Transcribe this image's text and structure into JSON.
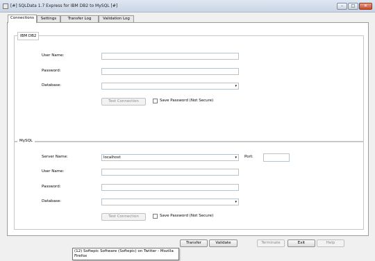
{
  "window": {
    "title": "[#] SQLData 1.7 Express for IBM DB2 to MySQL [#]",
    "controls": {
      "minimize": "–",
      "maximize": "□",
      "close": "✕"
    }
  },
  "tabs": [
    {
      "label": "Connections",
      "active": true
    },
    {
      "label": "Settings",
      "active": false
    },
    {
      "label": "Transfer Log",
      "active": false
    },
    {
      "label": "Validation Log",
      "active": false
    }
  ],
  "db2": {
    "legend": "IBM DB2",
    "user_name_label": "User Name:",
    "user_name_value": "",
    "password_label": "Password:",
    "password_value": "",
    "database_label": "Database:",
    "database_value": "",
    "test_connection": "Test Connection",
    "save_password_label": "Save Password (Not Secure)"
  },
  "mysql": {
    "legend": "MySQL",
    "server_name_label": "Server Name:",
    "server_name_value": "localhost",
    "port_label": "Port:",
    "port_value": "",
    "user_name_label": "User Name:",
    "user_name_value": "",
    "password_label": "Password:",
    "password_value": "",
    "database_label": "Database:",
    "database_value": "",
    "test_connection": "Test Connection",
    "save_password_label": "Save Password (Not Secure)"
  },
  "buttons": {
    "transfer": "Transfer",
    "validate": "Validate",
    "terminate": "Terminate",
    "exit": "Exit",
    "help": "Help"
  },
  "tooltip": {
    "text": "(12) Softepic Software (Softepic) on Twitter - Mozilla Firefox"
  },
  "icons": {
    "dropdown": "▾"
  }
}
